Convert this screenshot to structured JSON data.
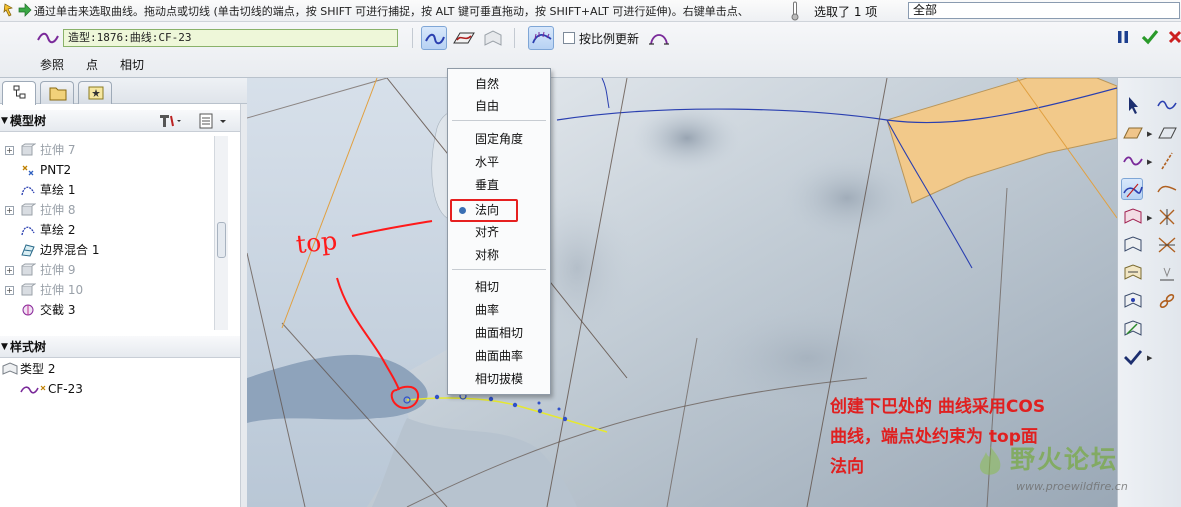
{
  "message_bar": {
    "text": "通过单击来选取曲线。拖动点或切线 (单击切线的端点，按 SHIFT 可进行捕捉，按 ALT 键可垂直拖动，按 SHIFT+ALT 可进行延伸)。右键单击点、",
    "selection_label": "选取了 1 项",
    "filter_value": "全部"
  },
  "dashboard": {
    "curve_field": "造型:1876:曲线:CF-23",
    "proportional_update_label": "按比例更新",
    "tabs": [
      "参照",
      "点",
      "相切"
    ]
  },
  "left_panel": {
    "model_tree": {
      "title": "模型树",
      "items": [
        {
          "label": "拉伸 7",
          "dim": true,
          "expandable": true
        },
        {
          "label": "PNT2",
          "dim": false,
          "expandable": false
        },
        {
          "label": "草绘 1",
          "dim": false,
          "expandable": false
        },
        {
          "label": "拉伸 8",
          "dim": true,
          "expandable": true
        },
        {
          "label": "草绘 2",
          "dim": false,
          "expandable": false
        },
        {
          "label": "边界混合 1",
          "dim": false,
          "expandable": false
        },
        {
          "label": "拉伸 9",
          "dim": true,
          "expandable": true
        },
        {
          "label": "拉伸 10",
          "dim": true,
          "expandable": true
        },
        {
          "label": "交截 3",
          "dim": false,
          "expandable": false
        }
      ]
    },
    "style_tree": {
      "title": "样式树",
      "items": [
        {
          "label": "类型 2"
        },
        {
          "label": "CF-23"
        }
      ]
    }
  },
  "context_menu": {
    "group1": [
      "自然",
      "自由"
    ],
    "group2": [
      "固定角度",
      "水平",
      "垂直",
      "法向",
      "对齐",
      "对称"
    ],
    "group3": [
      "相切",
      "曲率",
      "曲面相切",
      "曲面曲率",
      "相切拔模"
    ],
    "selected": "法向"
  },
  "annotations": {
    "handwritten": "top",
    "note_lines": [
      "创建下巴处的 曲线采用COS",
      "曲线，端点处约束为 top面",
      "法向"
    ]
  },
  "watermark": {
    "title": "野火论坛",
    "url": "www.proewildfire.cn"
  },
  "colors": {
    "note_red": "#e02020",
    "surface_orange": "#f2c98a",
    "curve_yellow": "#e6e830",
    "curve_point_blue": "#3050c8",
    "selection_blue": "#b7d2f3"
  },
  "icons": {
    "tip": "green-arrow-icon",
    "thermometer": "thermometer-icon",
    "pause": "pause-icon",
    "ok": "check-icon",
    "cancel": "close-icon"
  }
}
